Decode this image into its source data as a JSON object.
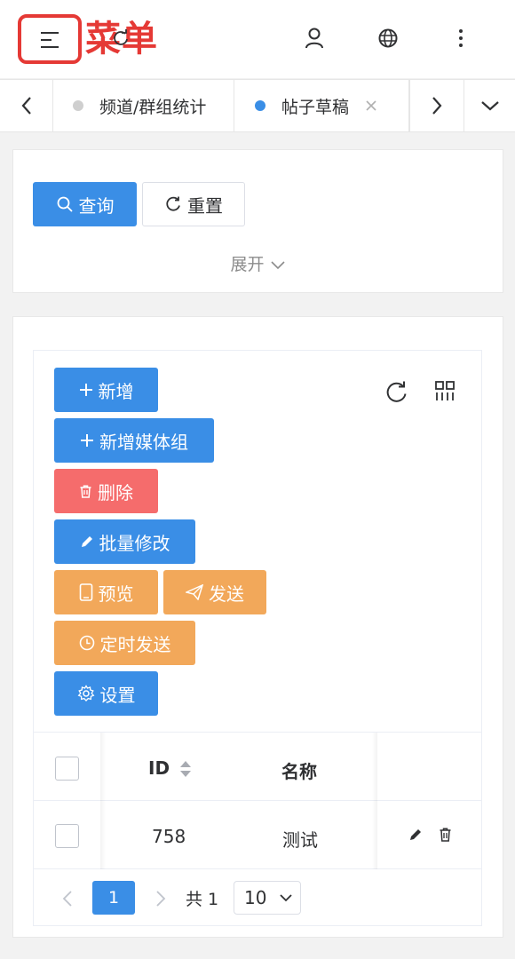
{
  "header": {
    "menu_label": "菜单"
  },
  "tabs": {
    "items": [
      {
        "label": "频道/群组统计",
        "active": false
      },
      {
        "label": "帖子草稿",
        "active": true
      }
    ]
  },
  "search": {
    "query_label": "查询",
    "reset_label": "重置",
    "expand_label": "展开"
  },
  "toolbar": {
    "add_label": "新增",
    "add_media_group_label": "新增媒体组",
    "delete_label": "删除",
    "batch_edit_label": "批量修改",
    "preview_label": "预览",
    "send_label": "发送",
    "scheduled_send_label": "定时发送",
    "settings_label": "设置"
  },
  "table": {
    "columns": [
      "ID",
      "名称"
    ],
    "rows": [
      {
        "id": "758",
        "name": "测试"
      }
    ]
  },
  "pagination": {
    "current_page": "1",
    "total_label": "共 1",
    "page_size": "10"
  },
  "colors": {
    "primary": "#3a8ee6",
    "danger": "#f56c6c",
    "warning": "#f2a85a",
    "highlight": "#e53935"
  }
}
